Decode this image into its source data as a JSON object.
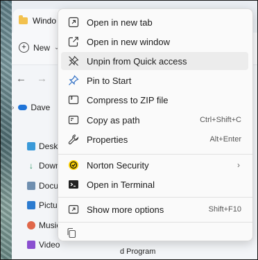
{
  "explorer": {
    "tab_title": "Windo",
    "new_label": "New",
    "sidebar": {
      "cloud_item": "Dave",
      "items": [
        "Desk",
        "Down",
        "Docu",
        "Pictu",
        "Music",
        "Video"
      ]
    },
    "content_snippet": "d Program"
  },
  "context_menu": {
    "items": [
      {
        "label": "Open in new tab",
        "icon": "open-in-new-tab-icon"
      },
      {
        "label": "Open in new window",
        "icon": "open-in-new-window-icon"
      },
      {
        "label": "Unpin from Quick access",
        "icon": "unpin-icon"
      },
      {
        "label": "Pin to Start",
        "icon": "pin-icon"
      },
      {
        "label": "Compress to ZIP file",
        "icon": "zip-icon"
      },
      {
        "label": "Copy as path",
        "icon": "copy-path-icon",
        "shortcut": "Ctrl+Shift+C"
      },
      {
        "label": "Properties",
        "icon": "wrench-icon",
        "shortcut": "Alt+Enter"
      },
      {
        "label": "Norton Security",
        "icon": "norton-icon",
        "has_submenu": true
      },
      {
        "label": "Open in Terminal",
        "icon": "terminal-icon"
      },
      {
        "label": "Show more options",
        "icon": "show-more-icon",
        "shortcut": "Shift+F10"
      }
    ],
    "hovered_item": "Unpin from Quick access",
    "bottom_icon": "copy-icon"
  },
  "colors": {
    "accent": "#1f74d8",
    "norton_yellow": "#ffd200"
  }
}
